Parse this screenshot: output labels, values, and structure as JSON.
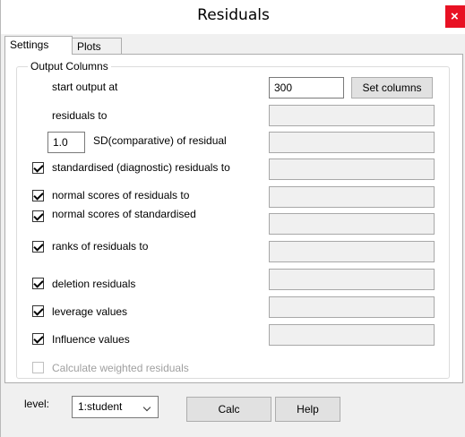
{
  "window": {
    "title": "Residuals",
    "close_label": "×"
  },
  "tabs": [
    {
      "label": "Settings"
    },
    {
      "label": "Plots"
    }
  ],
  "output_group": {
    "title": "Output Columns",
    "start_output_label": "start output at",
    "start_output_value": "300",
    "set_columns_label": "Set columns",
    "residuals_to_label": "residuals to",
    "sd_value": "1.0",
    "sd_label": "SD(comparative) of residual",
    "rows": [
      {
        "label": "standardised (diagnostic) residuals to",
        "checked": true
      },
      {
        "label": "normal scores of residuals to",
        "checked": true
      },
      {
        "label": "normal scores of standardised",
        "checked": true
      },
      {
        "label": "ranks of residuals to",
        "checked": true
      },
      {
        "label": "deletion residuals",
        "checked": true
      },
      {
        "label": "leverage values",
        "checked": true
      },
      {
        "label": "Influence values",
        "checked": true
      }
    ],
    "weighted": {
      "label": "Calculate weighted residuals",
      "checked": false,
      "enabled": false
    }
  },
  "footer": {
    "level_label": "level:",
    "level_selected": "1:student",
    "calc_label": "Calc",
    "help_label": "Help"
  }
}
